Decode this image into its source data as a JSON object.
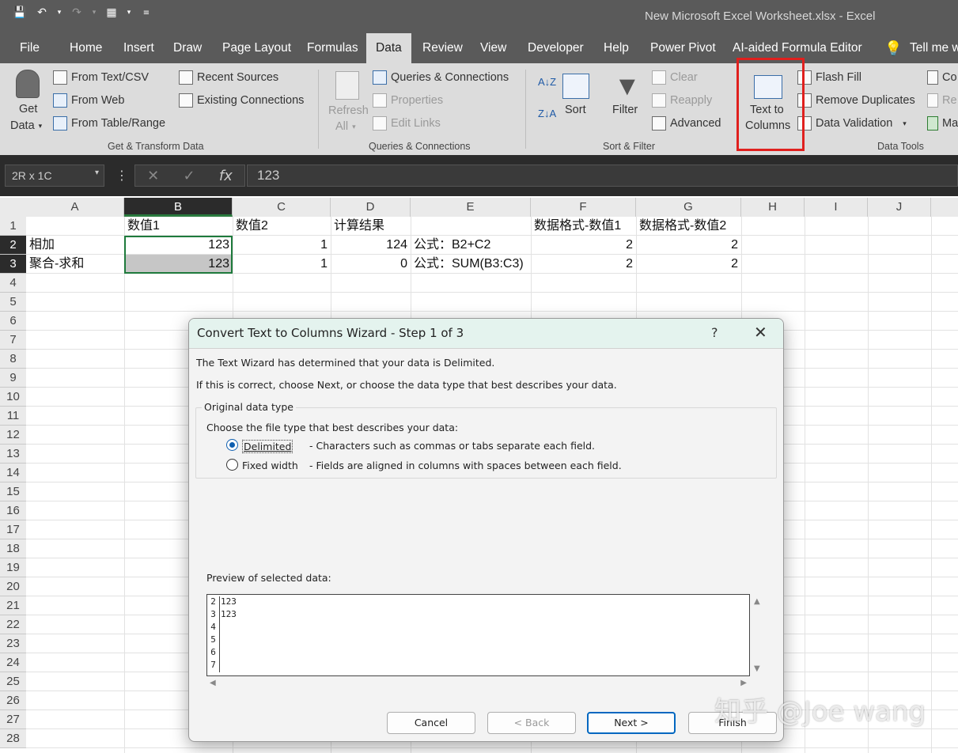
{
  "window": {
    "title": "New Microsoft Excel Worksheet.xlsx  -  Excel"
  },
  "menu": [
    "File",
    "Home",
    "Insert",
    "Draw",
    "Page Layout",
    "Formulas",
    "Data",
    "Review",
    "View",
    "Developer",
    "Help",
    "Power Pivot",
    "AI-aided Formula Editor",
    "Tell me w"
  ],
  "active_tab": "Data",
  "ribbon": {
    "get_data": [
      "Get",
      "Data"
    ],
    "from_text_csv": "From Text/CSV",
    "from_web": "From Web",
    "from_table_range": "From Table/Range",
    "recent_sources": "Recent Sources",
    "existing_connections": "Existing Connections",
    "group_get_transform": "Get & Transform Data",
    "refresh_all": [
      "Refresh",
      "All"
    ],
    "queries_connections": "Queries & Connections",
    "properties": "Properties",
    "edit_links": "Edit Links",
    "group_queries": "Queries & Connections",
    "sort": "Sort",
    "filter": "Filter",
    "clear": "Clear",
    "reapply": "Reapply",
    "advanced": "Advanced",
    "group_sort_filter": "Sort & Filter",
    "text_to_columns": [
      "Text to",
      "Columns"
    ],
    "flash_fill": "Flash Fill",
    "remove_duplicates": "Remove Duplicates",
    "data_validation": "Data Validation",
    "group_data_tools": "Data Tools",
    "cut_labels": [
      "Co",
      "Re",
      "Ma"
    ]
  },
  "formula_bar": {
    "name_box": "2R x 1C",
    "value": "123"
  },
  "columns": [
    "A",
    "B",
    "C",
    "D",
    "E",
    "F",
    "G",
    "H",
    "I",
    "J"
  ],
  "rows": [
    "1",
    "2",
    "3",
    "4",
    "5",
    "6",
    "7",
    "8",
    "9",
    "10",
    "11",
    "12",
    "13",
    "14",
    "15",
    "16",
    "17",
    "18",
    "19",
    "20",
    "21",
    "22",
    "23",
    "24",
    "25",
    "26",
    "27",
    "28"
  ],
  "cells": {
    "B1": "数值1",
    "C1": "数值2",
    "D1": "计算结果",
    "F1": "数据格式-数值1",
    "G1": "数据格式-数值2",
    "A2": "相加",
    "B2": "123",
    "C2": "1",
    "D2": "124",
    "E2": "公式：B2+C2",
    "F2": "2",
    "G2": "2",
    "A3": "聚合-求和",
    "B3": "123",
    "C3": "1",
    "D3": "0",
    "E3": "公式：SUM(B3:C3)",
    "F3": "2",
    "G3": "2"
  },
  "dialog": {
    "title": "Convert Text to Columns Wizard - Step 1 of 3",
    "help": "?",
    "line1": "The Text Wizard has determined that your data is Delimited.",
    "line2": "If this is correct, choose Next, or choose the data type that best describes your data.",
    "group_label": "Original data type",
    "choose_label": "Choose the file type that best describes your data:",
    "options": [
      {
        "label": "Delimited",
        "desc": "- Characters such as commas or tabs separate each field.",
        "selected": true
      },
      {
        "label": "Fixed width",
        "desc": "- Fields are aligned in columns with spaces between each field.",
        "selected": false
      }
    ],
    "preview_label": "Preview of selected data:",
    "preview_rows": [
      {
        "n": "2",
        "v": "123"
      },
      {
        "n": "3",
        "v": "123"
      },
      {
        "n": "4",
        "v": ""
      },
      {
        "n": "5",
        "v": ""
      },
      {
        "n": "6",
        "v": ""
      },
      {
        "n": "7",
        "v": ""
      }
    ],
    "buttons": {
      "cancel": "Cancel",
      "back": "< Back",
      "next": "Next >",
      "finish": "Finish"
    }
  },
  "watermark": "知乎 @Joe wang",
  "colors": {
    "accent_red": "#e0201e",
    "select_green": "#1e7a3c",
    "default_button": "#0067c0"
  }
}
